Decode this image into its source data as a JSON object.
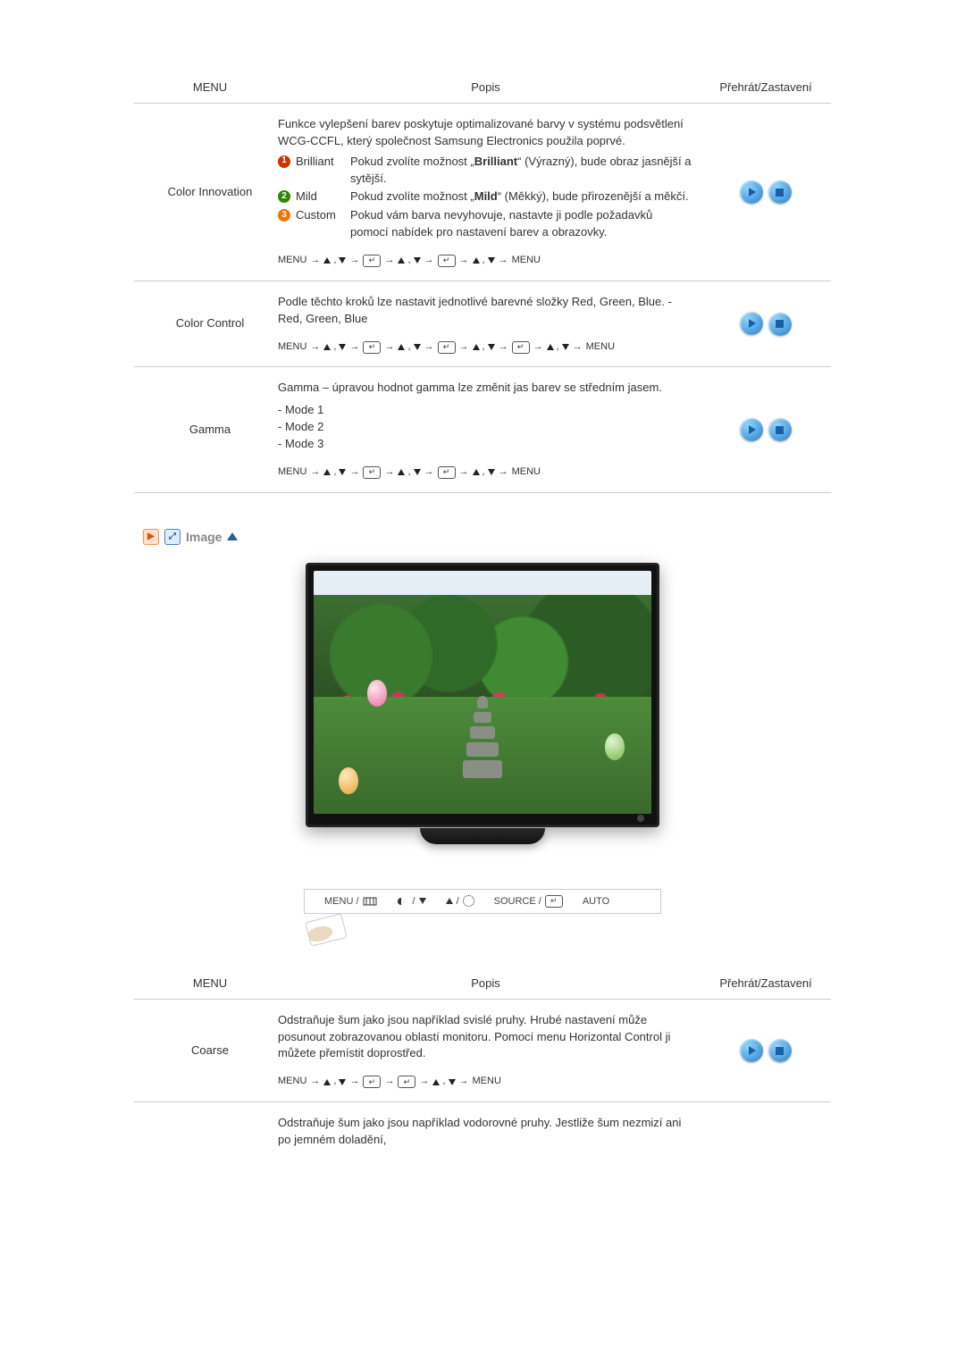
{
  "headers": {
    "menu": "MENU",
    "popis": "Popis",
    "play": "Přehrát/Zastavení"
  },
  "rows1": {
    "color_innovation": {
      "label": "Color Innovation",
      "intro": "Funkce vylepšení barev poskytuje optimalizované barvy v systému podsvětlení WCG-CCFL, který společnost Samsung Electronics použila poprvé.",
      "opt1_name": "Brilliant",
      "opt1_pre": "Pokud zvolíte možnost „",
      "opt1_bold": "Brilliant",
      "opt1_post": "“ (Výrazný), bude obraz jasnější a sytější.",
      "opt2_name": "Mild",
      "opt2_pre": "Pokud zvolíte možnost „",
      "opt2_bold": "Mild",
      "opt2_post": "“ (Měkký), bude přirozenější a měkčí.",
      "opt3_name": "Custom",
      "opt3_text": "Pokud vám barva nevyhovuje, nastavte ji podle požadavků pomocí nabídek pro nastavení barev a obrazovky.",
      "nav_menu": "MENU"
    },
    "color_control": {
      "label": "Color Control",
      "text": "Podle těchto kroků lze nastavit jednotlivé barevné složky Red, Green, Blue. -Red, Green, Blue",
      "nav_menu": "MENU"
    },
    "gamma": {
      "label": "Gamma",
      "text": "Gamma – úpravou hodnot gamma lze změnit jas barev se středním jasem.",
      "mode1": "- Mode 1",
      "mode2": "- Mode 2",
      "mode3": "- Mode 3",
      "nav_menu": "MENU"
    }
  },
  "section_image": "Image",
  "button_bar": {
    "menu": "MENU /",
    "source": "SOURCE /",
    "auto": "AUTO"
  },
  "rows2": {
    "coarse": {
      "label": "Coarse",
      "text": "Odstraňuje šum jako jsou například svislé pruhy. Hrubé nastavení může posunout zobrazovanou oblastí monitoru. Pomocí menu Horizontal Control ji můžete přemístit doprostřed.",
      "nav_menu": "MENU"
    },
    "fine_partial": "Odstraňuje šum jako jsou například vodorovné pruhy. Jestliže šum nezmizí ani po jemném doladění,"
  }
}
